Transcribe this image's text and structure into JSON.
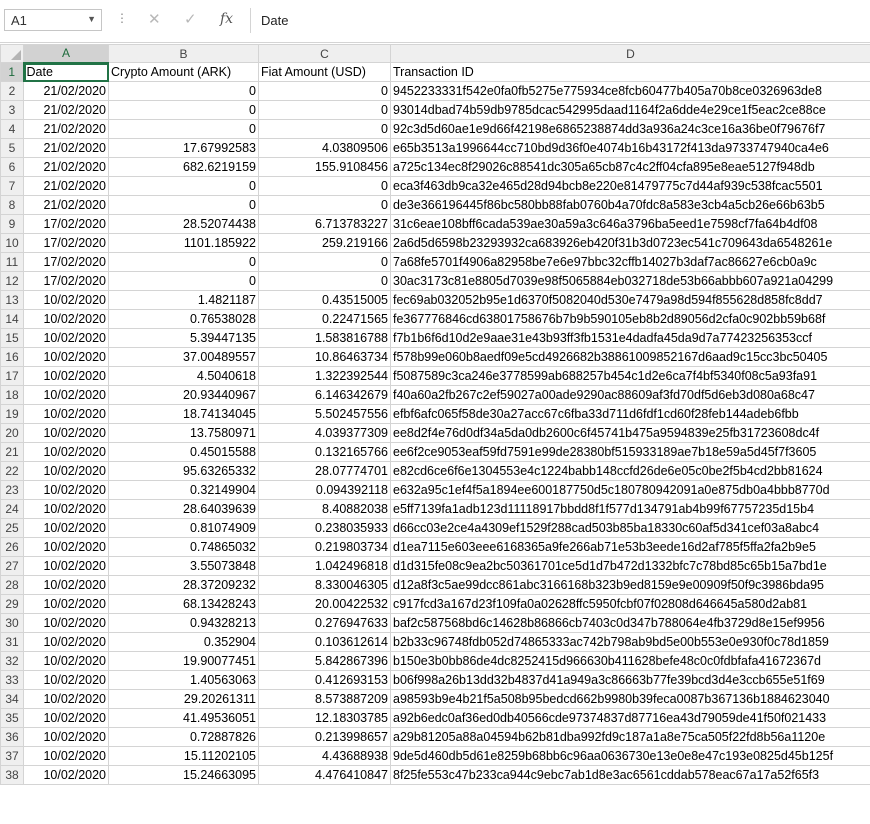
{
  "formula_bar": {
    "name_box": "A1",
    "content": "Date"
  },
  "columns": [
    "A",
    "B",
    "C",
    "D"
  ],
  "header_row": [
    "Date",
    "Crypto Amount (ARK)",
    "Fiat Amount (USD)",
    "Transaction ID"
  ],
  "rows": [
    [
      "21/02/2020",
      "0",
      "0",
      "9452233331f542e0fa0fb5275e775934ce8fcb60477b405a70b8ce0326963de8"
    ],
    [
      "21/02/2020",
      "0",
      "0",
      "93014dbad74b59db9785dcac542995daad1164f2a6dde4e29ce1f5eac2ce88ce"
    ],
    [
      "21/02/2020",
      "0",
      "0",
      "92c3d5d60ae1e9d66f42198e6865238874dd3a936a24c3ce16a36be0f79676f7"
    ],
    [
      "21/02/2020",
      "17.67992583",
      "4.03809506",
      "e65b3513a1996644cc710bd9d36f0e4074b16b43172f413da9733747940ca4e6"
    ],
    [
      "21/02/2020",
      "682.6219159",
      "155.9108456",
      "a725c134ec8f29026c88541dc305a65cb87c4c2ff04cfa895e8eae5127f948db"
    ],
    [
      "21/02/2020",
      "0",
      "0",
      "eca3f463db9ca32e465d28d94bcb8e220e81479775c7d44af939c538fcac5501"
    ],
    [
      "21/02/2020",
      "0",
      "0",
      "de3e366196445f86bc580bb88fab0760b4a70fdc8a583e3cb4a5cb26e66b63b5"
    ],
    [
      "17/02/2020",
      "28.52074438",
      "6.713783227",
      "31c6eae108bff6cada539ae30a59a3c646a3796ba5eed1e7598cf7fa64b4df08"
    ],
    [
      "17/02/2020",
      "1101.185922",
      "259.219166",
      "2a6d5d6598b23293932ca683926eb420f31b3d0723ec541c709643da6548261e"
    ],
    [
      "17/02/2020",
      "0",
      "0",
      "7a68fe5701f4906a82958be7e6e97bbc32cffb14027b3daf7ac86627e6cb0a9c"
    ],
    [
      "17/02/2020",
      "0",
      "0",
      "30ac3173c81e8805d7039e98f5065884eb032718de53b66abbb607a921a04299"
    ],
    [
      "10/02/2020",
      "1.4821187",
      "0.43515005",
      "fec69ab032052b95e1d6370f5082040d530e7479a98d594f855628d858fc8dd7"
    ],
    [
      "10/02/2020",
      "0.76538028",
      "0.22471565",
      "fe367776846cd63801758676b7b9b590105eb8b2d89056d2cfa0c902bb59b68f"
    ],
    [
      "10/02/2020",
      "5.39447135",
      "1.583816788",
      "f7b1b6f6d10d2e9aae31e43b93ff3fb1531e4dadfa45da9d7a77423256353ccf"
    ],
    [
      "10/02/2020",
      "37.00489557",
      "10.86463734",
      "f578b99e060b8aedf09e5cd4926682b38861009852167d6aad9c15cc3bc50405"
    ],
    [
      "10/02/2020",
      "4.5040618",
      "1.322392544",
      "f5087589c3ca246e3778599ab688257b454c1d2e6ca7f4bf5340f08c5a93fa91"
    ],
    [
      "10/02/2020",
      "20.93440967",
      "6.146342679",
      "f40a60a2fb267c2ef59027a00ade9290ac88609af3fd70df5d6eb3d080a68c47"
    ],
    [
      "10/02/2020",
      "18.74134045",
      "5.502457556",
      "efbf6afc065f58de30a27acc67c6fba33d711d6fdf1cd60f28feb144adeb6fbb"
    ],
    [
      "10/02/2020",
      "13.7580971",
      "4.039377309",
      "ee8d2f4e76d0df34a5da0db2600c6f45741b475a9594839e25fb31723608dc4f"
    ],
    [
      "10/02/2020",
      "0.45015588",
      "0.132165766",
      "ee6f2ce9053eaf59fd7591e99de28380bf515933189ae7b18e59a5d45f7f3605"
    ],
    [
      "10/02/2020",
      "95.63265332",
      "28.07774701",
      "e82cd6ce6f6e1304553e4c1224babb148ccfd26de6e05c0be2f5b4cd2bb81624"
    ],
    [
      "10/02/2020",
      "0.32149904",
      "0.094392118",
      "e632a95c1ef4f5a1894ee600187750d5c180780942091a0e875db0a4bbb8770d"
    ],
    [
      "10/02/2020",
      "28.64039639",
      "8.40882038",
      "e5ff7139fa1adb123d11118917bbdd8f1f577d134791ab4b99f67757235d15b4"
    ],
    [
      "10/02/2020",
      "0.81074909",
      "0.238035933",
      "d66cc03e2ce4a4309ef1529f288cad503b85ba18330c60af5d341cef03a8abc4"
    ],
    [
      "10/02/2020",
      "0.74865032",
      "0.219803734",
      "d1ea7115e603eee6168365a9fe266ab71e53b3eede16d2af785f5ffa2fa2b9e5"
    ],
    [
      "10/02/2020",
      "3.55073848",
      "1.042496818",
      "d1d315fe08c9ea2bc50361701ce5d1d7b472d1332bfc7c78bd85c65b15a7bd1e"
    ],
    [
      "10/02/2020",
      "28.37209232",
      "8.330046305",
      "d12a8f3c5ae99dcc861abc3166168b323b9ed8159e9e00909f50f9c3986bda95"
    ],
    [
      "10/02/2020",
      "68.13428243",
      "20.00422532",
      "c917fcd3a167d23f109fa0a02628ffc5950fcbf07f02808d646645a580d2ab81"
    ],
    [
      "10/02/2020",
      "0.94328213",
      "0.276947633",
      "baf2c587568bd6c14628b86866cb7403c0d347b788064e4fb3729d8e15ef9956"
    ],
    [
      "10/02/2020",
      "0.352904",
      "0.103612614",
      "b2b33c96748fdb052d74865333ac742b798ab9bd5e00b553e0e930f0c78d1859"
    ],
    [
      "10/02/2020",
      "19.90077451",
      "5.842867396",
      "b150e3b0bb86de4dc8252415d966630b411628befe48c0c0fdbfafa41672367d"
    ],
    [
      "10/02/2020",
      "1.40563063",
      "0.412693153",
      "b06f998a26b13dd32b4837d41a949a3c86663b77fe39bcd3d4e3ccb655e51f69"
    ],
    [
      "10/02/2020",
      "29.20261311",
      "8.573887209",
      "a98593b9e4b21f5a508b95bedcd662b9980b39feca0087b367136b1884623040"
    ],
    [
      "10/02/2020",
      "41.49536051",
      "12.18303785",
      "a92b6edc0af36ed0db40566cde97374837d87716ea43d79059de41f50f021433"
    ],
    [
      "10/02/2020",
      "0.72887826",
      "0.213998657",
      "a29b81205a88a04594b62b81dba992fd9c187a1a8e75ca505f22fd8b56a1120e"
    ],
    [
      "10/02/2020",
      "15.11202105",
      "4.43688938",
      "9de5d460db5d61e8259b68bb6c96aa0636730e13e0e8e47c193e0825d45b125f"
    ],
    [
      "10/02/2020",
      "15.24663095",
      "4.476410847",
      "8f25fe553c47b233ca944c9ebc7ab1d8e3ac6561cddab578eac67a17a52f65f3"
    ]
  ],
  "colors": {
    "accent": "#217346",
    "header_bg": "#efefef",
    "gridline": "#d4d4d4"
  }
}
